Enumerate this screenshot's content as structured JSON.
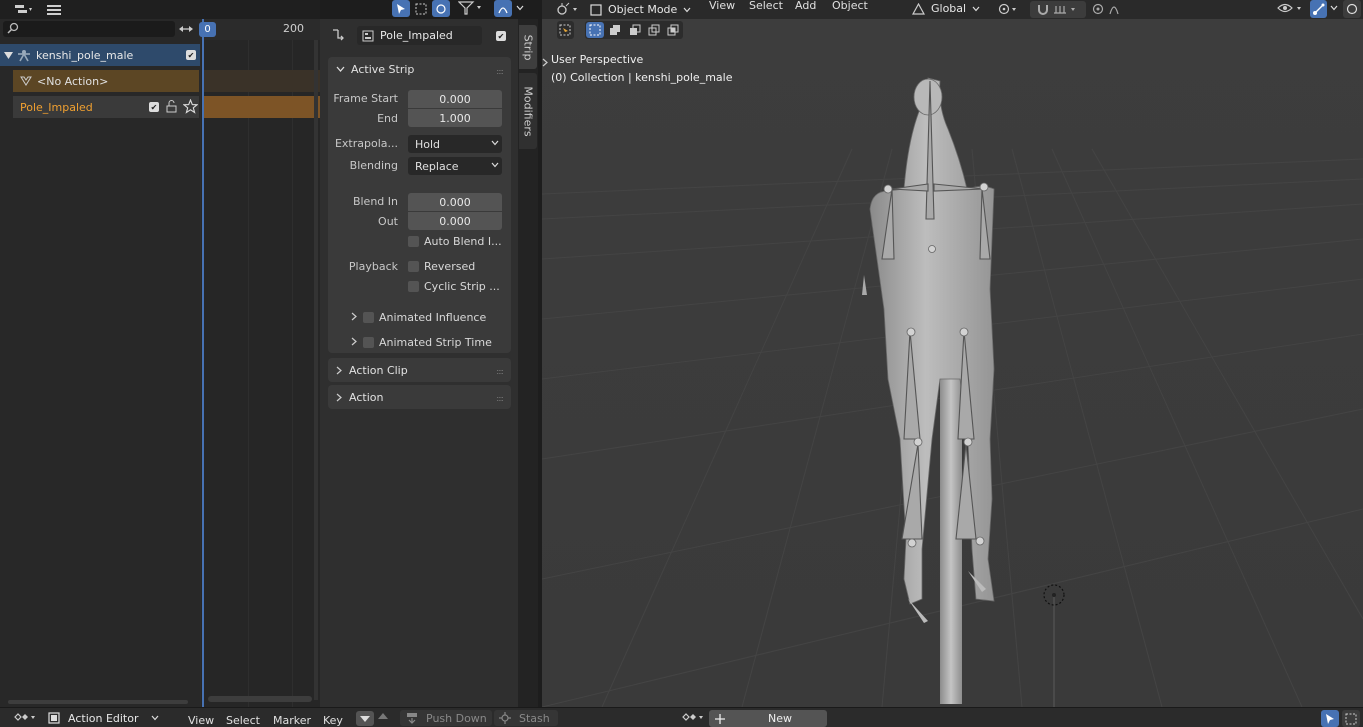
{
  "nla": {
    "search_placeholder": "",
    "frame_current": "0",
    "frame_label_200": "200",
    "channels": {
      "object_name": "kenshi_pole_male",
      "no_action": "<No Action>",
      "track_name": "Pole_Impaled"
    }
  },
  "sidebar": {
    "strip_name": "Pole_Impaled",
    "tabs": {
      "strip": "Strip",
      "modifiers": "Modifiers"
    },
    "active_strip": {
      "title": "Active Strip",
      "frame_start_label": "Frame Start",
      "frame_start": "0.000",
      "end_label": "End",
      "end": "1.000",
      "extrapolation_label": "Extrapola...",
      "extrapolation": "Hold",
      "blending_label": "Blending",
      "blending": "Replace",
      "blend_in_label": "Blend In",
      "blend_in": "0.000",
      "out_label": "Out",
      "out": "0.000",
      "auto_blend": "Auto Blend I...",
      "playback_label": "Playback",
      "reversed": "Reversed",
      "cyclic": "Cyclic Strip ...",
      "animated_influence": "Animated Influence",
      "animated_strip_time": "Animated Strip Time"
    },
    "action_clip": "Action Clip",
    "action": "Action"
  },
  "viewport": {
    "mode": "Object Mode",
    "menus": [
      "View",
      "Select",
      "Add",
      "Object"
    ],
    "orientation": "Global",
    "info_line1": "User Perspective",
    "info_line2": "(0) Collection | kenshi_pole_male"
  },
  "bottom": {
    "editor_type": "Action Editor",
    "menus": [
      "View",
      "Select",
      "Marker",
      "Key"
    ],
    "push_down": "Push Down",
    "stash": "Stash",
    "new": "New"
  },
  "colors": {
    "accent": "#4772b3",
    "strip_active": "#7d5426",
    "track_text": "#f0a030"
  }
}
